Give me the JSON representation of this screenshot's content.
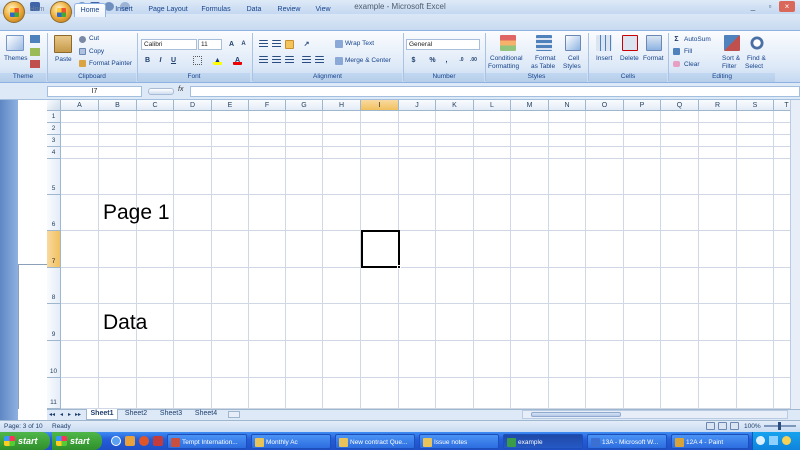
{
  "window": {
    "title": "example - Microsoft Excel"
  },
  "tabs": [
    "Home",
    "Insert",
    "Page Layout",
    "Formulas",
    "Data",
    "Review",
    "View"
  ],
  "bg_tabs": [
    "Hom",
    "Insert",
    "Page Layout"
  ],
  "ribbon": {
    "themes": {
      "label": "Themes",
      "group": "Theme"
    },
    "clipboard": {
      "paste": "Paste",
      "cut": "Cut",
      "copy": "Copy",
      "format_painter": "Format Painter",
      "group": "Clipboard"
    },
    "font": {
      "name": "Calibri",
      "size": "11",
      "group": "Font"
    },
    "alignment": {
      "wrap": "Wrap Text",
      "merge": "Merge & Center",
      "group": "Alignment"
    },
    "number": {
      "format": "General",
      "currency": "$",
      "percent": "%",
      "comma": ",",
      "group": "Number"
    },
    "styles": {
      "cond": "Conditional",
      "cond2": "Formatting",
      "fmt_table": "Format",
      "fmt_table2": "as Table",
      "cell_styles": "Cell",
      "cell_styles2": "Styles",
      "group": "Styles"
    },
    "cells": {
      "insert": "Insert",
      "delete": "Delete",
      "format": "Format",
      "group": "Cells"
    },
    "editing": {
      "autosum": "AutoSum",
      "fill": "Fill",
      "clear": "Clear",
      "sort": "Sort &",
      "sort2": "Filter",
      "find": "Find &",
      "find2": "Select",
      "group": "Editing"
    }
  },
  "formula_bar": {
    "name_box": "I7",
    "fx": "fx",
    "content": ""
  },
  "columns": [
    "A",
    "B",
    "C",
    "D",
    "E",
    "F",
    "G",
    "H",
    "I",
    "J",
    "K",
    "L",
    "M",
    "N",
    "O",
    "P",
    "Q",
    "R",
    "S",
    "T"
  ],
  "selected_column": "I",
  "rows": [
    "1",
    "2",
    "3",
    "4",
    "5",
    "6",
    "7",
    "8",
    "9",
    "10",
    "11"
  ],
  "selected_row": "7",
  "cells": {
    "b6": "Page 1",
    "b9": "Data"
  },
  "sheets": [
    "Sheet1",
    "Sheet2",
    "Sheet3",
    "Sheet4"
  ],
  "active_sheet": "Sheet1",
  "status": {
    "page": "Page: 3 of 10",
    "ready": "Ready",
    "zoom": "100%"
  },
  "taskbar": {
    "start": "start",
    "start2": "start",
    "items": [
      "Tempt Internation...",
      "Monthly Ac",
      "New contract Que...",
      "Issue notes",
      "example",
      "13A - Microsoft W...",
      "12A 4 - Paint"
    ],
    "active_item": "example"
  }
}
